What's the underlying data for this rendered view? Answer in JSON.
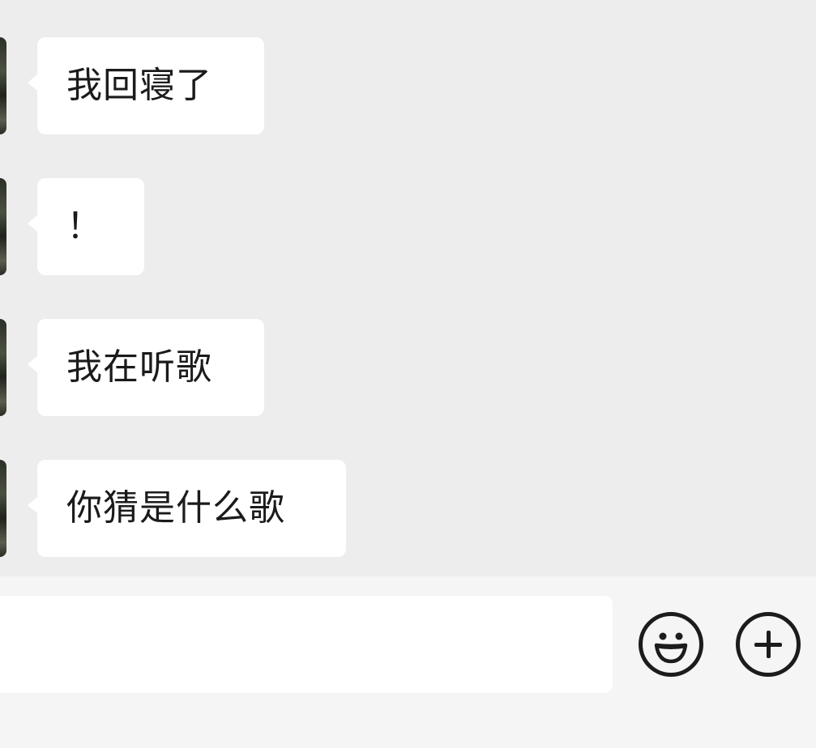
{
  "messages": [
    {
      "text": "我回寝了"
    },
    {
      "text": "！"
    },
    {
      "text": "我在听歌"
    },
    {
      "text": "你猜是什么歌"
    }
  ],
  "composer": {
    "value": "",
    "emoji_icon": "smile-emoji-icon",
    "plus_icon": "plus-circle-icon"
  },
  "colors": {
    "chat_background": "#ededed",
    "bubble": "#ffffff",
    "input_bar": "#f5f5f5",
    "icon_stroke": "#1c1c1c"
  }
}
